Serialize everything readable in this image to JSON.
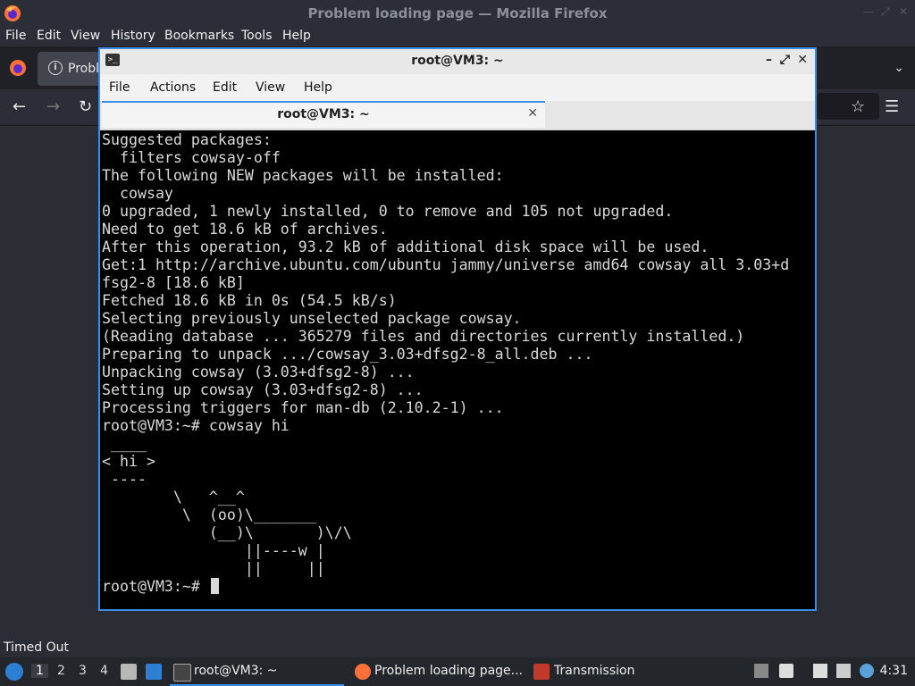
{
  "firefox": {
    "window_title": "Problem loading page — Mozilla Firefox",
    "menu": [
      "File",
      "Edit",
      "View",
      "History",
      "Bookmarks",
      "Tools",
      "Help"
    ],
    "tab_title": "Probl",
    "icons": {
      "logo": "firefox-icon",
      "info": "info-icon",
      "back": "back-arrow-icon",
      "forward": "forward-arrow-icon",
      "reload": "reload-icon",
      "bookmark": "star-icon",
      "menu": "hamburger-icon"
    }
  },
  "terminal": {
    "window_title": "root@VM3: ~",
    "menu": [
      "File",
      "Actions",
      "Edit",
      "View",
      "Help"
    ],
    "tab_title": "root@VM3: ~",
    "tab_close": "✕",
    "output": "Suggested packages:\n  filters cowsay-off\nThe following NEW packages will be installed:\n  cowsay\n0 upgraded, 1 newly installed, 0 to remove and 105 not upgraded.\nNeed to get 18.6 kB of archives.\nAfter this operation, 93.2 kB of additional disk space will be used.\nGet:1 http://archive.ubuntu.com/ubuntu jammy/universe amd64 cowsay all 3.03+d\nfsg2-8 [18.6 kB]\nFetched 18.6 kB in 0s (54.5 kB/s)\nSelecting previously unselected package cowsay.\n(Reading database ... 365279 files and directories currently installed.)\nPreparing to unpack .../cowsay_3.03+dfsg2-8_all.deb ...\nUnpacking cowsay (3.03+dfsg2-8) ...\nSetting up cowsay (3.03+dfsg2-8) ...\nProcessing triggers for man-db (2.10.2-1) ...\nroot@VM3:~# cowsay hi\n ____\n< hi >\n ----\n        \\   ^__^\n         \\  (oo)\\_______\n            (__)\\       )\\/\\\n                ||----w |\n                ||     ||\n",
    "prompt": "root@VM3:~# "
  },
  "tooltip": "Timed Out",
  "taskbar": {
    "workspaces": [
      "1",
      "2",
      "3",
      "4"
    ],
    "tasks": [
      {
        "label": "root@VM3: ~",
        "icon": "terminal-icon"
      },
      {
        "label": "Problem loading page...",
        "icon": "firefox-icon"
      },
      {
        "label": "Transmission",
        "icon": "transmission-icon"
      }
    ],
    "clock": "4:31"
  }
}
